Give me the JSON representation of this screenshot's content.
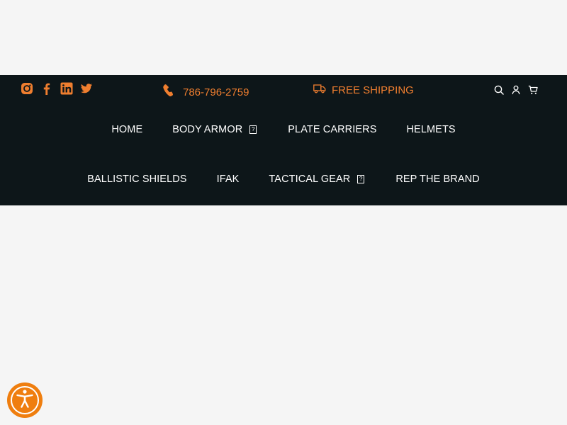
{
  "colors": {
    "accent": "#ef7e2f",
    "header_bg": "#0d1619",
    "page_bg": "#f5f5f5",
    "nav_text": "#ffffff"
  },
  "social": [
    {
      "name": "instagram-icon"
    },
    {
      "name": "facebook-icon"
    },
    {
      "name": "linkedin-icon"
    },
    {
      "name": "twitter-icon"
    }
  ],
  "topbar": {
    "phone": "786-796-2759",
    "shipping": "FREE SHIPPING"
  },
  "nav": {
    "row1": [
      "HOME",
      "BODY ARMOR",
      "PLATE CARRIERS",
      "HELMETS"
    ],
    "row2": [
      "BALLISTIC SHIELDS",
      "IFAK",
      "TACTICAL GEAR",
      "REP THE BRAND"
    ],
    "dropdown_glyph": "?"
  }
}
